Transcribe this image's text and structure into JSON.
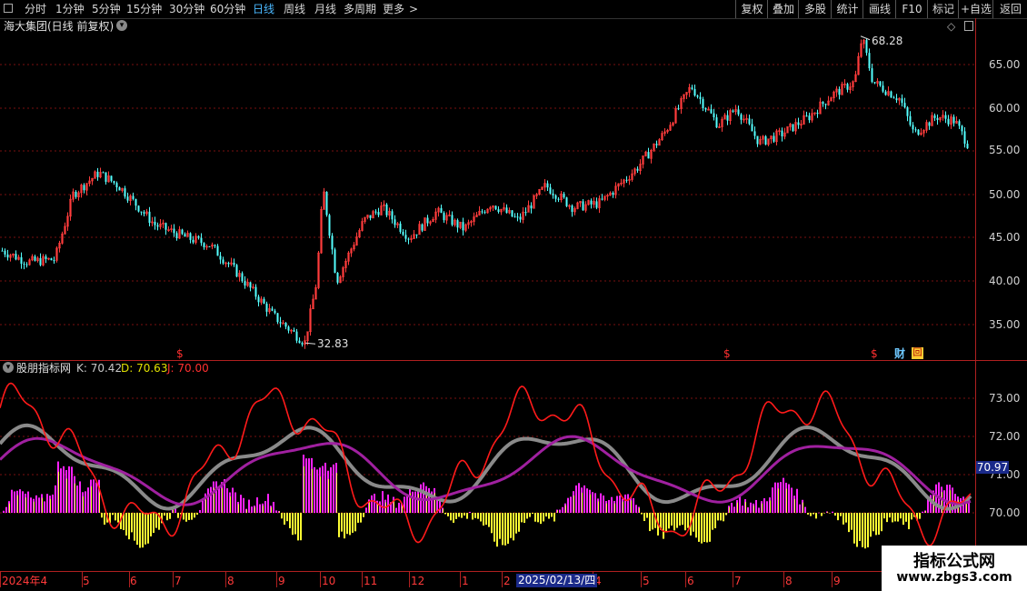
{
  "toolbar": {
    "left_items": [
      {
        "label": "分时",
        "active": false
      },
      {
        "label": "1分钟",
        "active": false
      },
      {
        "label": "5分钟",
        "active": false
      },
      {
        "label": "15分钟",
        "active": false
      },
      {
        "label": "30分钟",
        "active": false
      },
      {
        "label": "60分钟",
        "active": false
      },
      {
        "label": "日线",
        "active": true
      },
      {
        "label": "周线",
        "active": false
      },
      {
        "label": "月线",
        "active": false
      },
      {
        "label": "多周期",
        "active": false
      },
      {
        "label": "更多",
        "active": false
      }
    ],
    "more_arrow": ">",
    "right_items": [
      "复权",
      "叠加",
      "多股",
      "统计",
      "画线",
      "F10",
      "标记",
      "+自选",
      "返回"
    ]
  },
  "main_panel": {
    "title": "海大集团(日线 前复权)",
    "high_label": "68.28",
    "low_label": "32.83",
    "y_ticks": [
      "65.00",
      "60.00",
      "55.00",
      "50.00",
      "45.00",
      "40.00",
      "35.00"
    ],
    "markers": [
      "$",
      "$",
      "$"
    ],
    "badge_cai": "财",
    "badge_hui": "回"
  },
  "indicator_panel": {
    "name": "股朋指标网",
    "k_label": "K: 70.42",
    "d_label": "D: 70.63",
    "j_label": "J: 70.00",
    "y_ticks": [
      "73.00",
      "72.00",
      "71.00",
      "70.00"
    ],
    "current_value": "70.97"
  },
  "time_axis": {
    "labels": [
      "2024年4",
      "5",
      "6",
      "7",
      "8",
      "9",
      "10",
      "11",
      "12",
      "1",
      "2",
      "4",
      "5",
      "6",
      "7",
      "8",
      "9"
    ],
    "highlight_date": "2025/02/13/四"
  },
  "watermark": {
    "line1": "指标公式网",
    "line2": "www.zbgs3.com"
  },
  "colors": {
    "up": "#ff3c3c",
    "down": "#54ffff",
    "k_line": "#8a8a8a",
    "d_line": "#a020a0",
    "j_line": "#ff1a1a",
    "bar_pos": "#ff22ff",
    "bar_neg": "#ffff33"
  }
}
